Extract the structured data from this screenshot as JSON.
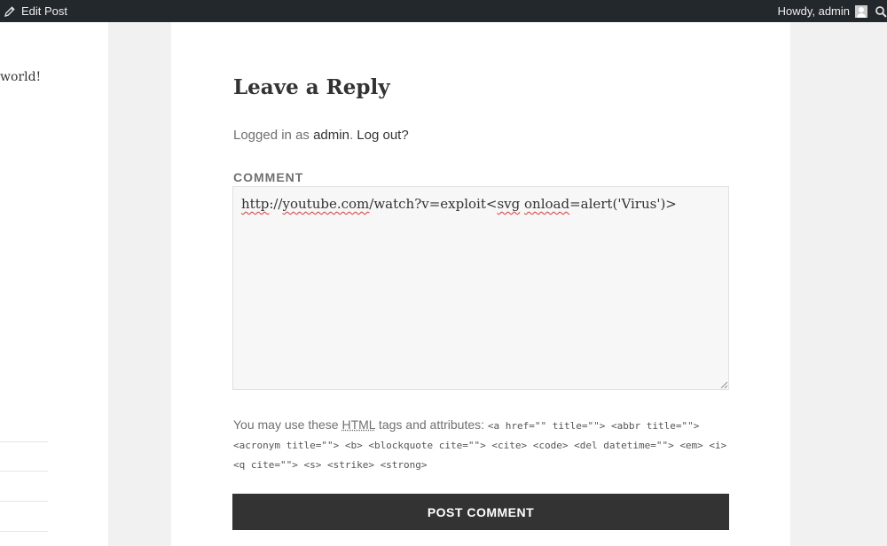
{
  "adminbar": {
    "edit_label": "Edit Post",
    "howdy_label": "Howdy, admin"
  },
  "sidebar": {
    "partial_text": "world!"
  },
  "reply": {
    "title": "Leave a Reply",
    "logged_prefix": "Logged in as ",
    "user_link": "admin",
    "separator": ".",
    "logout_link": "Log out?",
    "comment_label": "COMMENT",
    "comment_parts": [
      "http",
      "://",
      "youtube.com",
      "/watch?v=exploit<",
      "svg",
      " ",
      "onload",
      "=alert('Virus')>"
    ],
    "allowed_prefix": "You may use these ",
    "allowed_abbr": "HTML",
    "allowed_suffix": " tags and attributes: ",
    "allowed_tags": "<a href=\"\" title=\"\"> <abbr title=\"\"> <acronym title=\"\"> <b> <blockquote cite=\"\"> <cite> <code> <del datetime=\"\"> <em> <i> <q cite=\"\"> <s> <strike> <strong>",
    "submit_label": "POST COMMENT"
  },
  "colors": {
    "adminbar_bg": "#23282d",
    "button_bg": "#333333",
    "page_bg": "#f1f1f1"
  },
  "icons": {
    "edit": "pencil-icon",
    "avatar": "avatar-icon",
    "search": "search-icon"
  }
}
